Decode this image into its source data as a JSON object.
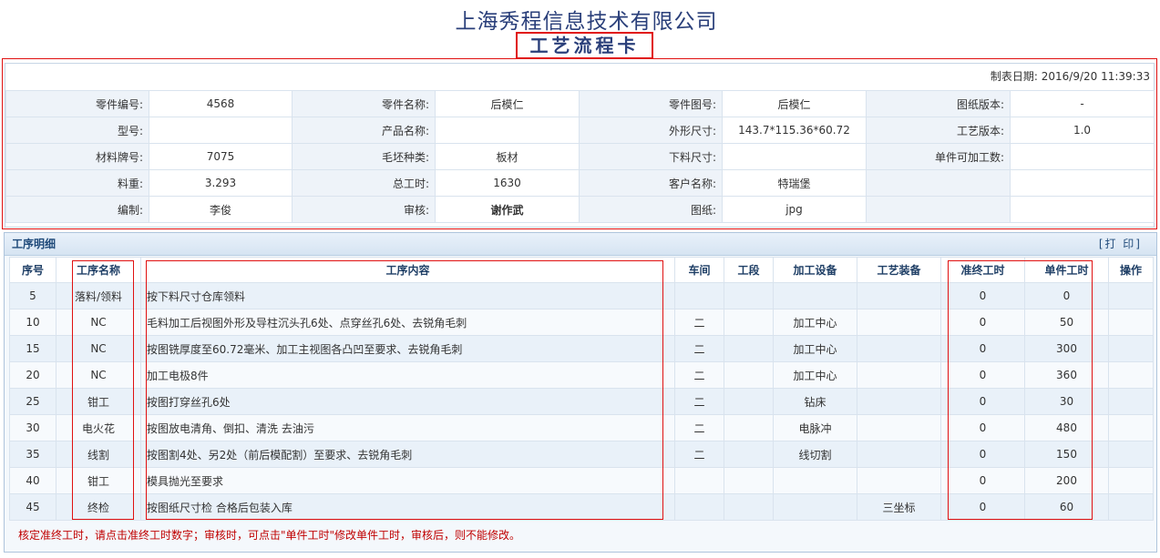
{
  "header": {
    "company": "上海秀程信息技术有限公司",
    "card_title": "工艺流程卡"
  },
  "info": {
    "date_label": "制表日期:",
    "date_value": "2016/9/20 11:39:33",
    "rows": [
      [
        {
          "l": "零件编号:",
          "v": "4568"
        },
        {
          "l": "零件名称:",
          "v": "后模仁"
        },
        {
          "l": "零件图号:",
          "v": "后模仁"
        },
        {
          "l": "图纸版本:",
          "v": "-"
        }
      ],
      [
        {
          "l": "型号:",
          "v": ""
        },
        {
          "l": "产品名称:",
          "v": ""
        },
        {
          "l": "外形尺寸:",
          "v": "143.7*115.36*60.72"
        },
        {
          "l": "工艺版本:",
          "v": "1.0"
        }
      ],
      [
        {
          "l": "材料牌号:",
          "v": "7075"
        },
        {
          "l": "毛坯种类:",
          "v": "板材"
        },
        {
          "l": "下料尺寸:",
          "v": ""
        },
        {
          "l": "单件可加工数:",
          "v": ""
        }
      ],
      [
        {
          "l": "料重:",
          "v": "3.293"
        },
        {
          "l": "总工时:",
          "v": "1630"
        },
        {
          "l": "客户名称:",
          "v": "特瑞堡"
        },
        {
          "l": "",
          "v": ""
        }
      ],
      [
        {
          "l": "编制:",
          "v": "李俊"
        },
        {
          "l": "审核:",
          "v": "谢作武"
        },
        {
          "l": "图纸:",
          "v": "jpg"
        },
        {
          "l": "",
          "v": ""
        }
      ]
    ]
  },
  "detail": {
    "title": "工序明细",
    "print_label": "[打 印]",
    "columns": [
      "序号",
      "工序名称",
      "工序内容",
      "车间",
      "工段",
      "加工设备",
      "工艺装备",
      "准终工时",
      "单件工时",
      "操作"
    ],
    "rows": [
      [
        "5",
        "落料/领料",
        "按下料尺寸仓库领料",
        "",
        "",
        "",
        "",
        "0",
        "0",
        ""
      ],
      [
        "10",
        "NC",
        "毛料加工后视图外形及导柱沉头孔6处、点穿丝孔6处、去锐角毛刺",
        "二",
        "",
        "加工中心",
        "",
        "0",
        "50",
        ""
      ],
      [
        "15",
        "NC",
        "按图铣厚度至60.72毫米、加工主视图各凸凹至要求、去锐角毛刺",
        "二",
        "",
        "加工中心",
        "",
        "0",
        "300",
        ""
      ],
      [
        "20",
        "NC",
        "加工电极8件",
        "二",
        "",
        "加工中心",
        "",
        "0",
        "360",
        ""
      ],
      [
        "25",
        "钳工",
        "按图打穿丝孔6处",
        "二",
        "",
        "钻床",
        "",
        "0",
        "30",
        ""
      ],
      [
        "30",
        "电火花",
        "按图放电清角、倒扣、清洗 去油污",
        "二",
        "",
        "电脉冲",
        "",
        "0",
        "480",
        ""
      ],
      [
        "35",
        "线割",
        "按图割4处、另2处（前后模配割）至要求、去锐角毛刺",
        "二",
        "",
        "线切割",
        "",
        "0",
        "150",
        ""
      ],
      [
        "40",
        "钳工",
        "模具抛光至要求",
        "",
        "",
        "",
        "",
        "0",
        "200",
        ""
      ],
      [
        "45",
        "终检",
        "按图纸尺寸检 合格后包装入库",
        "",
        "",
        "",
        "三坐标",
        "0",
        "60",
        ""
      ]
    ],
    "note": "核定准终工时，请点击准终工时数字；审核时，可点击\"单件工时\"修改单件工时，审核后，则不能修改。"
  }
}
